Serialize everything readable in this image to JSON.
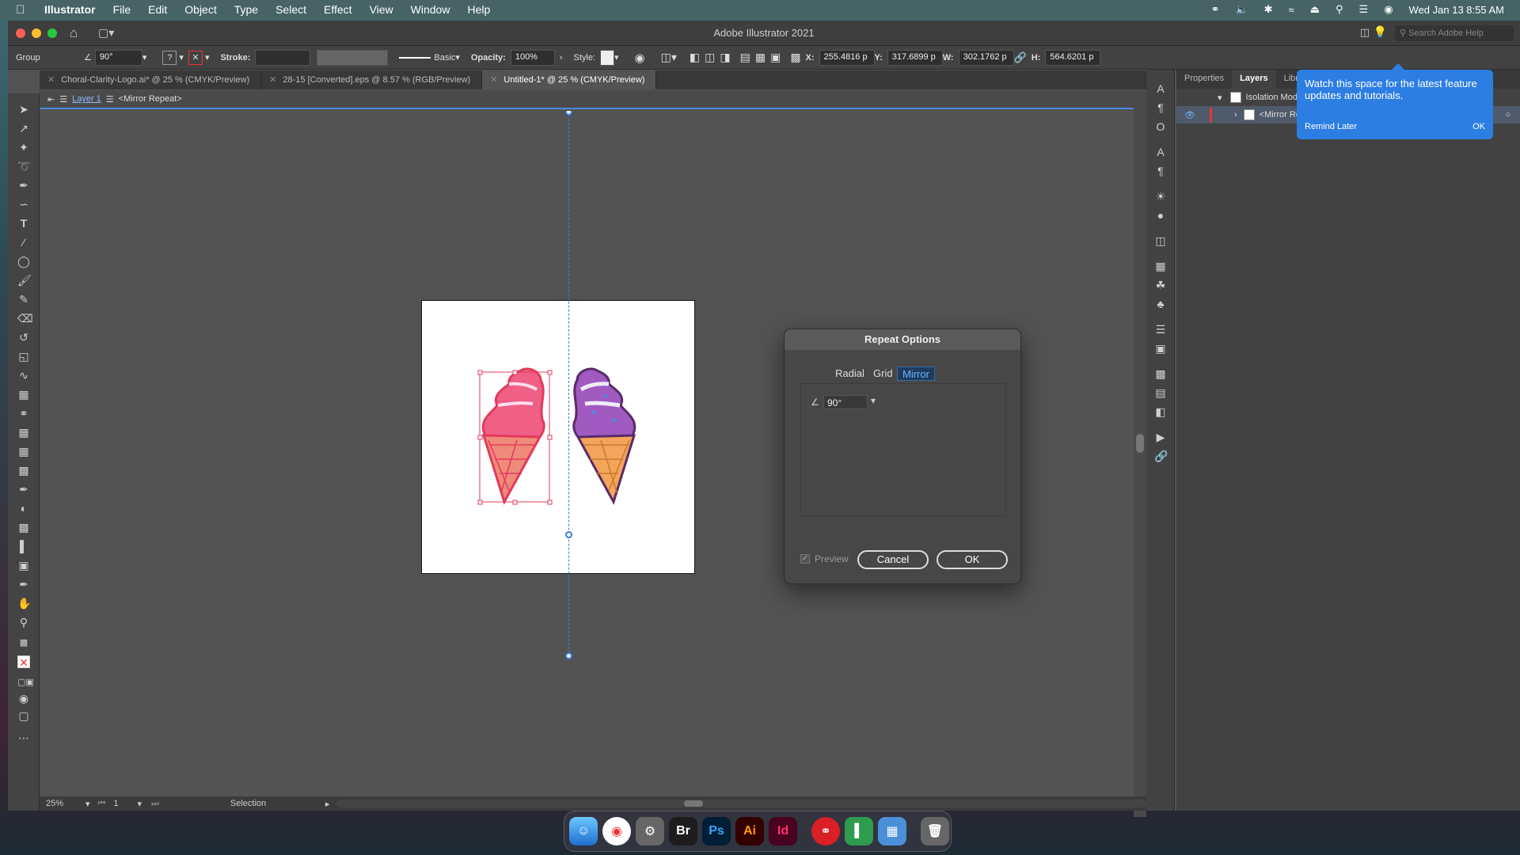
{
  "menubar": {
    "app_name": "Illustrator",
    "items": [
      "File",
      "Edit",
      "Object",
      "Type",
      "Select",
      "Effect",
      "View",
      "Window",
      "Help"
    ],
    "datetime": "Wed Jan 13  8:55 AM"
  },
  "window": {
    "title": "Adobe Illustrator 2021",
    "search_placeholder": "Search Adobe Help"
  },
  "control_bar": {
    "selection_type": "Group",
    "angle": "90°",
    "stroke_label": "Stroke:",
    "brush": "Basic",
    "opacity_label": "Opacity:",
    "opacity_value": "100%",
    "style_label": "Style:",
    "x_label": "X:",
    "x_value": "255.4816 p",
    "y_label": "Y:",
    "y_value": "317.6899 p",
    "w_label": "W:",
    "w_value": "302.1762 p",
    "h_label": "H:",
    "h_value": "564.6201 p"
  },
  "tabs": [
    {
      "label": "Choral-Clarity-Logo.ai* @ 25 % (CMYK/Preview)"
    },
    {
      "label": "28-15 [Converted].eps @ 8.57 % (RGB/Preview)"
    },
    {
      "label": "Untitled-1* @ 25 % (CMYK/Preview)"
    }
  ],
  "breadcrumb": {
    "layer": "Layer 1",
    "object": "<Mirror Repeat>"
  },
  "status": {
    "zoom": "25%",
    "page": "1",
    "tool": "Selection"
  },
  "dialog": {
    "title": "Repeat Options",
    "tabs": [
      "Radial",
      "Grid",
      "Mirror"
    ],
    "selected_tab": "Mirror",
    "angle_value": "90°",
    "preview_label": "Preview",
    "cancel_label": "Cancel",
    "ok_label": "OK"
  },
  "panel": {
    "tabs": [
      "Properties",
      "Layers",
      "Libr"
    ],
    "active_tab": "Layers",
    "isolation_label": "Isolation Mode",
    "layer_item": "<Mirror Repeat>"
  },
  "tooltip": {
    "text": "Watch this space for the latest feature updates and tutorials.",
    "remind_label": "Remind Later",
    "ok_label": "OK"
  },
  "dock": {
    "apps": [
      "Finder",
      "Chrome",
      "System Preferences",
      "Br",
      "Ps",
      "Ai",
      "Id",
      "Creative Cloud",
      "Numbers",
      "Preview",
      "Trash"
    ]
  },
  "colors": {
    "accent": "#2d7ee3",
    "left_icecream": "#e23a5c",
    "right_icecream": "#8a3a9a"
  }
}
